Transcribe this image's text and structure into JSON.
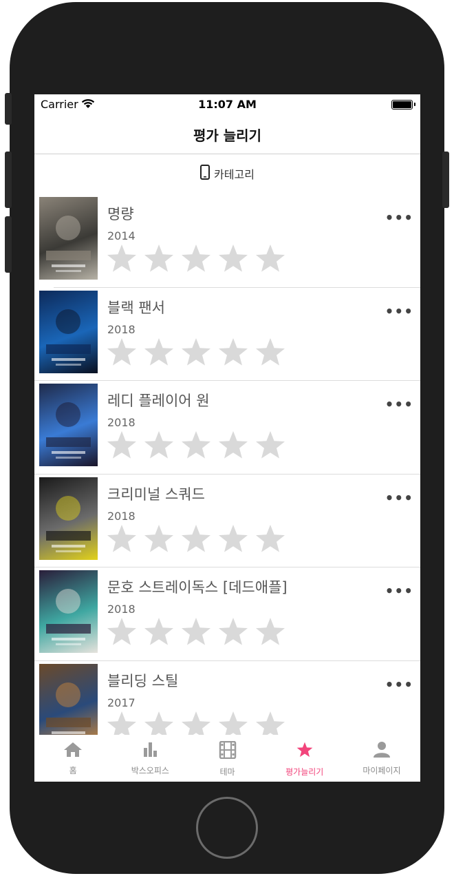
{
  "status_bar": {
    "carrier": "Carrier",
    "time": "11:07 AM"
  },
  "nav": {
    "title": "평가 늘리기"
  },
  "category": {
    "label": "카테고리"
  },
  "colors": {
    "accent": "#f2447b",
    "star_empty": "#d9d9d9",
    "tab_inactive": "#9a9a9a"
  },
  "movies": [
    {
      "title": "명량",
      "year": "2014",
      "rating": 0,
      "poster_colors": [
        "#8a8378",
        "#3b3a36",
        "#b7b2a6"
      ]
    },
    {
      "title": "블랙 팬서",
      "year": "2018",
      "rating": 0,
      "poster_colors": [
        "#0d2a5a",
        "#1a66b8",
        "#0a1020"
      ]
    },
    {
      "title": "레디 플레이어 원",
      "year": "2018",
      "rating": 0,
      "poster_colors": [
        "#1f2a4a",
        "#3a7bd5",
        "#1a1428"
      ]
    },
    {
      "title": "크리미널 스쿼드",
      "year": "2018",
      "rating": 0,
      "poster_colors": [
        "#1a1a1a",
        "#6b6b6b",
        "#e2d21a"
      ]
    },
    {
      "title": "문호 스트레이독스 [데드애플]",
      "year": "2018",
      "rating": 0,
      "poster_colors": [
        "#2a1e3a",
        "#3fa7a1",
        "#e6e2dc"
      ]
    },
    {
      "title": "블리딩 스틸",
      "year": "2017",
      "rating": 0,
      "poster_colors": [
        "#6b4a2a",
        "#2a4a7a",
        "#d08a3a"
      ]
    }
  ],
  "more_label": "•••",
  "tabs": [
    {
      "label": "홈",
      "icon": "home-icon",
      "active": false
    },
    {
      "label": "박스오피스",
      "icon": "bar-chart-icon",
      "active": false
    },
    {
      "label": "테마",
      "icon": "film-icon",
      "active": false
    },
    {
      "label": "평가늘리기",
      "icon": "star-icon",
      "active": true
    },
    {
      "label": "마이페이지",
      "icon": "person-icon",
      "active": false
    }
  ]
}
